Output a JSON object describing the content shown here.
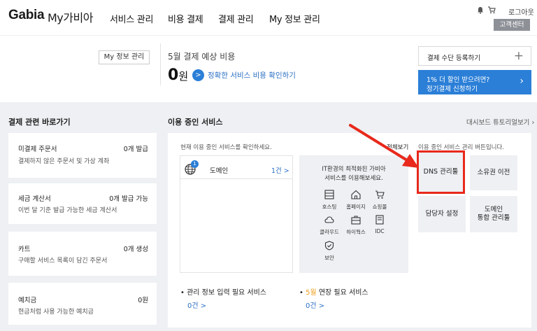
{
  "nav": {
    "logo": "Gabia",
    "logo_sub": "My가비아",
    "menu": [
      "서비스 관리",
      "비용 결제",
      "결제 관리",
      "My 정보 관리"
    ],
    "logout": "로그아웃",
    "customer_center": "고객센터"
  },
  "summary": {
    "my_info_btn": "My 정보 관리",
    "bill_title": "5월 결제 예상 비용",
    "bill_amount": "0",
    "bill_unit": "원",
    "bill_link_icon": ">",
    "bill_link": "정확한 서비스 비용 확인하기",
    "pay_register": "결제 수단 등록하기",
    "pay_register_icon": "+",
    "promo_line1": "1% 더 할인 받으려면?",
    "promo_line2": "정기결제 신청하기",
    "promo_chevron": "›"
  },
  "shortcuts": {
    "title": "결제 관련 바로가기",
    "cards": [
      {
        "title": "미결제 주문서",
        "value": "0개 발급",
        "desc": "결제하지 않은 주문서 및 가상 계좌"
      },
      {
        "title": "세금 계산서",
        "value": "0개 발급 가능",
        "desc": "이번 달 기준 발급 가능한 세금 계산서"
      },
      {
        "title": "카트",
        "value": "0개 생성",
        "desc": "구매할 서비스 목록이 담긴 주문서"
      },
      {
        "title": "예치금",
        "value": "0원",
        "desc": "현금처럼 사용 가능한 예치금"
      }
    ]
  },
  "services": {
    "title": "이용 중인 서비스",
    "tutorial_link": "대시보드 튜토리얼보기 ›",
    "left_hint": "현재 이용 중인 서비스를 확인하세요.",
    "view_all": "전체보기",
    "right_hint": "이용 중인 서비스 관리 버튼입니다.",
    "domain": {
      "badge": "1",
      "label": "도메인",
      "count": "1건 >"
    },
    "promo_text_1": "IT환경의 최적화된 가비아",
    "promo_text_2": "서비스를 이용해보세요.",
    "categories": [
      "호스팅",
      "홈페이지",
      "쇼핑몰",
      "클라우드",
      "하이웍스",
      "IDC",
      "보안"
    ],
    "tools": [
      {
        "label": "DNS 관리툴"
      },
      {
        "label": "소유권 이전"
      },
      {
        "label": "담당자 설정"
      },
      {
        "label_1": "도메인",
        "label_2": "통합 관리툴"
      }
    ],
    "bottom": {
      "info_needed": "관리 정보 입력 필요 서비스",
      "info_count": "0건 >",
      "renew_month": "5월",
      "renew_text": " 연장 필요 서비스",
      "renew_count": "0건 >",
      "bullet": "•"
    }
  },
  "colors": {
    "accent_blue": "#2b7fd7",
    "highlight_red": "#e8291c",
    "renew_orange": "#f0a020"
  }
}
